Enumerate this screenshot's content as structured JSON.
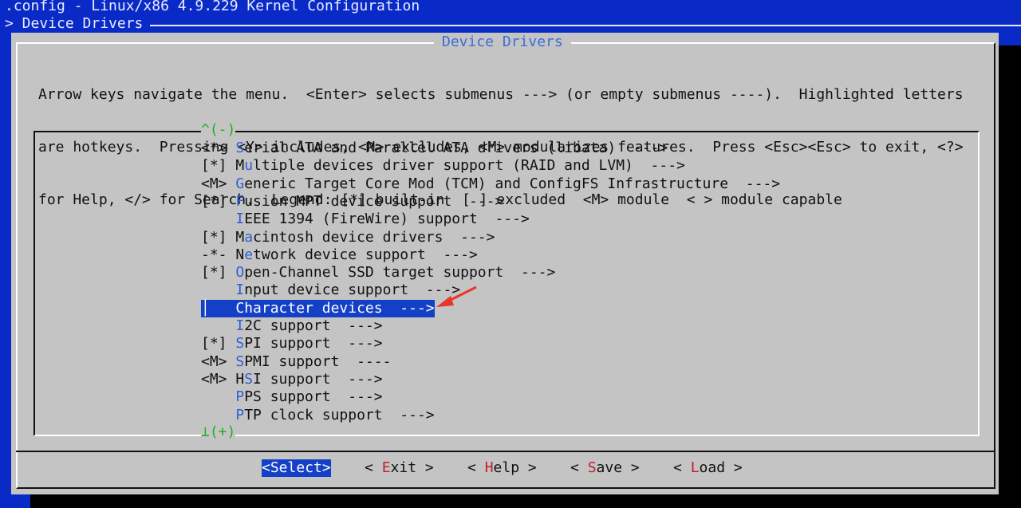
{
  "window": {
    "title": ".config - Linux/x86 4.9.229 Kernel Configuration",
    "breadcrumb": "> Device Drivers"
  },
  "dialog": {
    "title": "Device Drivers",
    "help_lines": [
      "Arrow keys navigate the menu.  <Enter> selects submenus ---> (or empty submenus ----).  Highlighted letters",
      "are hotkeys.  Pressing <Y> includes, <N> excludes, <M> modularizes features.  Press <Esc><Esc> to exit, <?>",
      "for Help, </> for Search.  Legend: [*] built-in  [ ] excluded  <M> module  < > module capable"
    ],
    "scroll_up": "^(-)",
    "scroll_down": "⊥(+)"
  },
  "menu_items": [
    {
      "prefix": "<*> ",
      "hotkey": "S",
      "rest": "erial ATA and Parallel ATA drivers (libata)  --->",
      "hk_offset": 0,
      "selected": false
    },
    {
      "prefix": "[*] ",
      "hotkey": "u",
      "rest": "ltiple devices driver support (RAID and LVM)  --->",
      "before": "M",
      "selected": false
    },
    {
      "prefix": "<M> ",
      "hotkey": "G",
      "rest": "eneric Target Core Mod (TCM) and ConfigFS Infrastructure  --->",
      "selected": false
    },
    {
      "prefix": "[*] ",
      "hotkey": "F",
      "rest": "usion MPT device support  --->",
      "selected": false
    },
    {
      "prefix": "    ",
      "hotkey": "I",
      "rest": "EEE 1394 (FireWire) support  --->",
      "selected": false
    },
    {
      "prefix": "[*] ",
      "hotkey": "a",
      "rest": "cintosh device drivers  --->",
      "before": "M",
      "selected": false
    },
    {
      "prefix": "-*- ",
      "hotkey": "e",
      "rest": "twork device support  --->",
      "before": "N",
      "selected": false
    },
    {
      "prefix": "[*] ",
      "hotkey": "O",
      "rest": "pen-Channel SSD target support  --->",
      "selected": false
    },
    {
      "prefix": "    ",
      "hotkey": "I",
      "rest": "nput device support  --->",
      "selected": false
    },
    {
      "prefix": "    ",
      "hotkey": "C",
      "rest": "haracter devices  --->",
      "selected": true
    },
    {
      "prefix": "    ",
      "hotkey": "I",
      "rest": "2C support  --->",
      "selected": false
    },
    {
      "prefix": "[*] ",
      "hotkey": "S",
      "rest": "PI support  --->",
      "selected": false
    },
    {
      "prefix": "<M> ",
      "hotkey": "S",
      "rest": "PMI support  ----",
      "selected": false
    },
    {
      "prefix": "<M> ",
      "hotkey": "S",
      "rest": "I support  --->",
      "before": "H",
      "selected": false
    },
    {
      "prefix": "    ",
      "hotkey": "P",
      "rest": "PS support  --->",
      "selected": false
    },
    {
      "prefix": "    ",
      "hotkey": "P",
      "rest": "TP clock support  --->",
      "selected": false
    }
  ],
  "buttons": [
    {
      "id": "select",
      "pre": "<",
      "hotkey": "Select",
      "post": ">",
      "active": true
    },
    {
      "id": "exit",
      "pre": "< ",
      "hotkey": "E",
      "post": "xit >",
      "active": false
    },
    {
      "id": "help",
      "pre": "< ",
      "hotkey": "H",
      "post": "elp >",
      "active": false
    },
    {
      "id": "save",
      "pre": "< ",
      "hotkey": "S",
      "post": "ave >",
      "active": false
    },
    {
      "id": "load",
      "pre": "< ",
      "hotkey": "L",
      "post": "oad >",
      "active": false
    }
  ],
  "colors": {
    "background": "#0a2ac8",
    "dialog": "#c4c4c4",
    "highlight": "#1440c8",
    "hotkey": "#2f5fd6",
    "button_hotkey": "#c0202a",
    "scroll_indicator": "#1fb01f",
    "annotation_arrow": "#e8352b"
  }
}
